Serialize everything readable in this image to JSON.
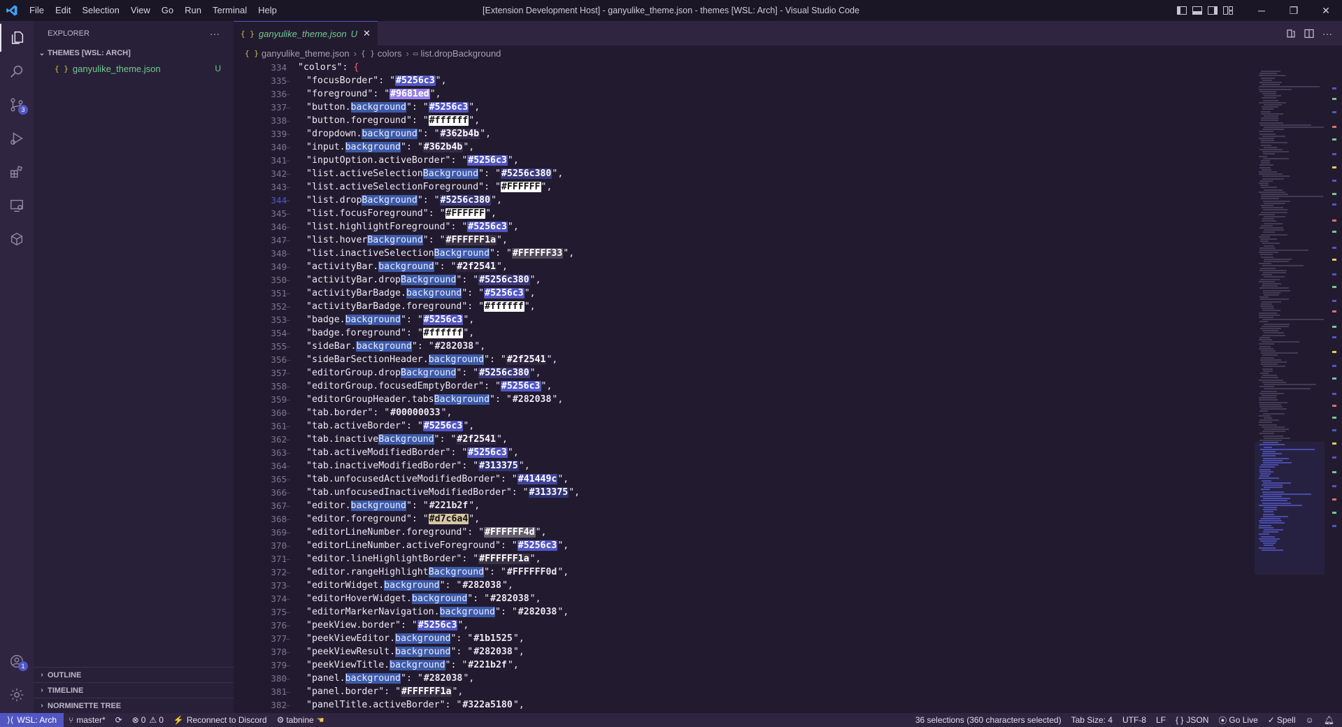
{
  "titlebar": {
    "window_title": "[Extension Development Host] - ganyulike_theme.json - themes [WSL: Arch] - Visual Studio Code",
    "menu": [
      "File",
      "Edit",
      "Selection",
      "View",
      "Go",
      "Run",
      "Terminal",
      "Help"
    ]
  },
  "activitybar": {
    "source_control_badge": "3",
    "accounts_badge": "1"
  },
  "sidebar": {
    "title": "EXPLORER",
    "more": "···",
    "folder": "THEMES [WSL: ARCH]",
    "file": {
      "name": "ganyulike_theme.json",
      "status": "U"
    },
    "sections": [
      "OUTLINE",
      "TIMELINE",
      "NORMINETTE TREE"
    ]
  },
  "editor": {
    "tab": {
      "label": "ganyulike_theme.json",
      "status": "U",
      "close": "✕"
    },
    "breadcrumbs": [
      "ganyulike_theme.json",
      "colors",
      "list.dropBackground"
    ],
    "active_line": 344,
    "lines": [
      {
        "n": "334",
        "k": "colors",
        "v": "{",
        "type": "open"
      },
      {
        "n": "335",
        "k": "focusBorder",
        "v": "#5256c3"
      },
      {
        "n": "336",
        "k": "foreground",
        "v": "#9681ed"
      },
      {
        "n": "337",
        "k": "button.",
        "kh": "background",
        "v": "#5256c3"
      },
      {
        "n": "338",
        "k": "button.foreground",
        "v": "#ffffff"
      },
      {
        "n": "339",
        "k": "dropdown.",
        "kh": "background",
        "v": "#362b4b"
      },
      {
        "n": "340",
        "k": "input.",
        "kh": "background",
        "v": "#362b4b"
      },
      {
        "n": "341",
        "k": "inputOption.activeBorder",
        "v": "#5256c3"
      },
      {
        "n": "342",
        "k": "list.activeSelection",
        "kh": "Background",
        "v": "#5256c380"
      },
      {
        "n": "343",
        "k": "list.activeSelectionForeground",
        "v": "#FFFFFF"
      },
      {
        "n": "344",
        "k": "list.drop",
        "kh": "Background",
        "v": "#5256c380"
      },
      {
        "n": "345",
        "k": "list.focusForeground",
        "v": "#FFFFFF"
      },
      {
        "n": "346",
        "k": "list.highlightForeground",
        "v": "#5256c3"
      },
      {
        "n": "347",
        "k": "list.hover",
        "kh": "Background",
        "v": "#FFFFFF1a"
      },
      {
        "n": "348",
        "k": "list.inactiveSelection",
        "kh": "Background",
        "v": "#FFFFFF33"
      },
      {
        "n": "349",
        "k": "activityBar.",
        "kh": "background",
        "v": "#2f2541"
      },
      {
        "n": "350",
        "k": "activityBar.drop",
        "kh": "Background",
        "v": "#5256c380"
      },
      {
        "n": "351",
        "k": "activityBarBadge.",
        "kh": "background",
        "v": "#5256c3"
      },
      {
        "n": "352",
        "k": "activityBarBadge.foreground",
        "v": "#ffffff"
      },
      {
        "n": "353",
        "k": "badge.",
        "kh": "background",
        "v": "#5256c3"
      },
      {
        "n": "354",
        "k": "badge.foreground",
        "v": "#ffffff"
      },
      {
        "n": "355",
        "k": "sideBar.",
        "kh": "background",
        "v": "#282038"
      },
      {
        "n": "356",
        "k": "sideBarSectionHeader.",
        "kh": "background",
        "v": "#2f2541"
      },
      {
        "n": "357",
        "k": "editorGroup.drop",
        "kh": "Background",
        "v": "#5256c380"
      },
      {
        "n": "358",
        "k": "editorGroup.focusedEmptyBorder",
        "v": "#5256c3"
      },
      {
        "n": "359",
        "k": "editorGroupHeader.tabs",
        "kh": "Background",
        "v": "#282038"
      },
      {
        "n": "360",
        "k": "tab.border",
        "v": "#00000033"
      },
      {
        "n": "361",
        "k": "tab.activeBorder",
        "v": "#5256c3"
      },
      {
        "n": "362",
        "k": "tab.inactive",
        "kh": "Background",
        "v": "#2f2541"
      },
      {
        "n": "363",
        "k": "tab.activeModifiedBorder",
        "v": "#5256c3"
      },
      {
        "n": "364",
        "k": "tab.inactiveModifiedBorder",
        "v": "#313375"
      },
      {
        "n": "365",
        "k": "tab.unfocusedActiveModifiedBorder",
        "v": "#41449c"
      },
      {
        "n": "366",
        "k": "tab.unfocusedInactiveModifiedBorder",
        "v": "#313375"
      },
      {
        "n": "367",
        "k": "editor.",
        "kh": "background",
        "v": "#221b2f"
      },
      {
        "n": "368",
        "k": "editor.foreground",
        "v": "#d7c6a4"
      },
      {
        "n": "369",
        "k": "editorLineNumber.foreground",
        "v": "#FFFFFF4d"
      },
      {
        "n": "370",
        "k": "editorLineNumber.activeForeground",
        "v": "#5256c3"
      },
      {
        "n": "371",
        "k": "editor.lineHighlightBorder",
        "v": "#FFFFFF1a"
      },
      {
        "n": "372",
        "k": "editor.rangeHighlight",
        "kh": "Background",
        "v": "#FFFFFF0d"
      },
      {
        "n": "373",
        "k": "editorWidget.",
        "kh": "background",
        "v": "#282038"
      },
      {
        "n": "374",
        "k": "editorHoverWidget.",
        "kh": "background",
        "v": "#282038"
      },
      {
        "n": "375",
        "k": "editorMarkerNavigation.",
        "kh": "background",
        "v": "#282038"
      },
      {
        "n": "376",
        "k": "peekView.border",
        "v": "#5256c3"
      },
      {
        "n": "377",
        "k": "peekViewEditor.",
        "kh": "background",
        "v": "#1b1525"
      },
      {
        "n": "378",
        "k": "peekViewResult.",
        "kh": "background",
        "v": "#282038"
      },
      {
        "n": "379",
        "k": "peekViewTitle.",
        "kh": "background",
        "v": "#221b2f"
      },
      {
        "n": "380",
        "k": "panel.",
        "kh": "background",
        "v": "#282038"
      },
      {
        "n": "381",
        "k": "panel.border",
        "v": "#FFFFFF1a"
      },
      {
        "n": "382",
        "k": "panelTitle.activeBorder",
        "v": "#322a5180"
      }
    ]
  },
  "statusbar": {
    "remote": "WSL: Arch",
    "branch": "master*",
    "problems": "0",
    "warnings": "0",
    "discord": "Reconnect to Discord",
    "tabnine": "tabnine",
    "selections": "36 selections (360 characters selected)",
    "tab_size": "Tab Size: 4",
    "encoding": "UTF-8",
    "eol": "LF",
    "language": "JSON",
    "golive": "Go Live",
    "spell": "Spell"
  },
  "colors": {
    "accent": "#5256c3",
    "editor_bg": "#221b2f",
    "sidebar_bg": "#282038",
    "activitybar_bg": "#2f2541",
    "untracked": "#73c991"
  }
}
